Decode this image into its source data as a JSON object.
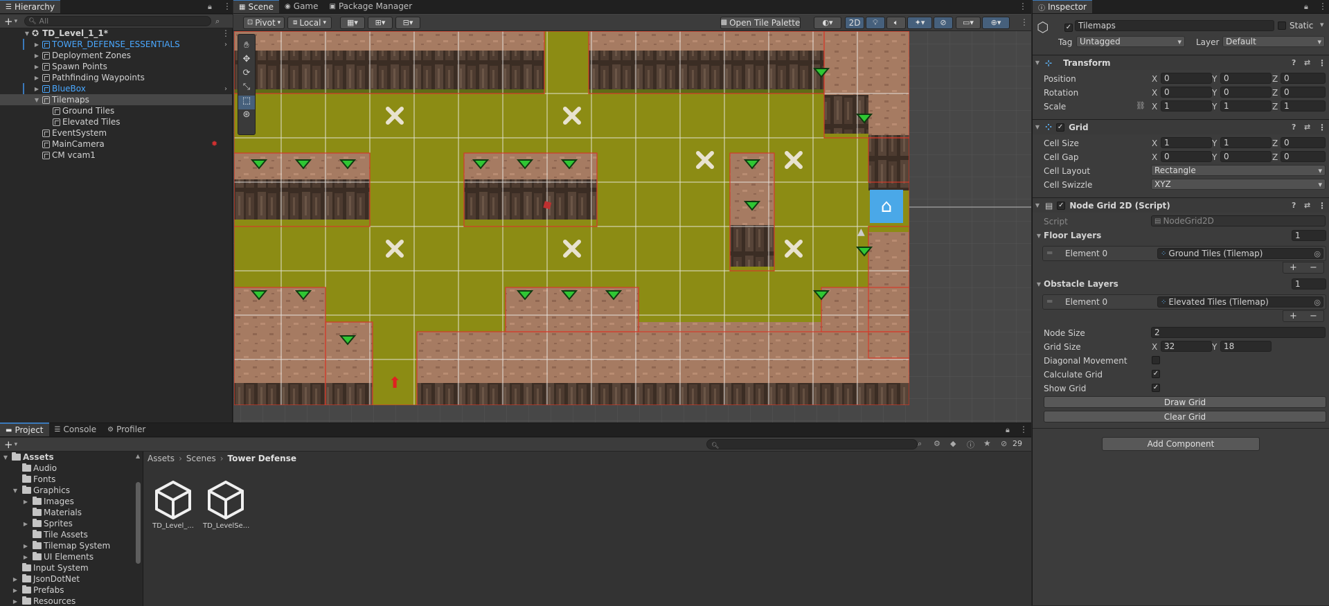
{
  "hierarchy": {
    "tab_label": "Hierarchy",
    "search_placeholder": "All",
    "scene_name": "TD_Level_1_1*",
    "items": [
      {
        "label": "TOWER_DEFENSE_ESSENTIALS",
        "color": "#4aa8ff"
      },
      {
        "label": "Deployment Zones"
      },
      {
        "label": "Spawn Points"
      },
      {
        "label": "Pathfinding Waypoints"
      },
      {
        "label": "BlueBox",
        "color": "#4aa8ff"
      },
      {
        "label": "Tilemaps"
      },
      {
        "label": "Ground Tiles"
      },
      {
        "label": "Elevated Tiles"
      },
      {
        "label": "EventSystem"
      },
      {
        "label": "MainCamera"
      },
      {
        "label": "CM vcam1"
      }
    ]
  },
  "scene_tabs": [
    {
      "label": "Scene",
      "icon": "grid-icon"
    },
    {
      "label": "Game",
      "icon": "gamepad-icon"
    },
    {
      "label": "Package Manager",
      "icon": "package-icon"
    }
  ],
  "scene_toolbar": {
    "pivot": "Pivot",
    "local": "Local",
    "open_tile_palette": "Open Tile Palette",
    "mode_2d": "2D"
  },
  "inspector": {
    "tab_label": "Inspector",
    "object_name": "Tilemaps",
    "static_label": "Static",
    "tag_label": "Tag",
    "tag_value": "Untagged",
    "layer_label": "Layer",
    "layer_value": "Default",
    "transform": {
      "title": "Transform",
      "position_label": "Position",
      "position": [
        "0",
        "0",
        "0"
      ],
      "rotation_label": "Rotation",
      "rotation": [
        "0",
        "0",
        "0"
      ],
      "scale_label": "Scale",
      "scale": [
        "1",
        "1",
        "1"
      ]
    },
    "grid": {
      "title": "Grid",
      "cell_size_label": "Cell Size",
      "cell_size": [
        "1",
        "1",
        "0"
      ],
      "cell_gap_label": "Cell Gap",
      "cell_gap": [
        "0",
        "0",
        "0"
      ],
      "cell_layout_label": "Cell Layout",
      "cell_layout": "Rectangle",
      "cell_swizzle_label": "Cell Swizzle",
      "cell_swizzle": "XYZ"
    },
    "node_grid": {
      "title": "Node Grid 2D (Script)",
      "script_label": "Script",
      "script_value": "NodeGrid2D",
      "floor_layers_label": "Floor Layers",
      "floor_layers_count": "1",
      "floor_element_label": "Element 0",
      "floor_element_value": "Ground Tiles (Tilemap)",
      "obstacle_layers_label": "Obstacle Layers",
      "obstacle_layers_count": "1",
      "obstacle_element_label": "Element 0",
      "obstacle_element_value": "Elevated Tiles (Tilemap)",
      "node_size_label": "Node Size",
      "node_size": "2",
      "grid_size_label": "Grid Size",
      "grid_size_x": "32",
      "grid_size_y": "18",
      "diagonal_label": "Diagonal Movement",
      "diagonal": false,
      "calculate_label": "Calculate Grid",
      "calculate": true,
      "show_label": "Show Grid",
      "show": true,
      "draw_button": "Draw Grid",
      "clear_button": "Clear Grid"
    },
    "add_component": "Add Component",
    "axis_x": "X",
    "axis_y": "Y",
    "axis_z": "Z"
  },
  "project": {
    "tabs": [
      {
        "label": "Project",
        "icon": "folder-icon"
      },
      {
        "label": "Console",
        "icon": "console-icon"
      },
      {
        "label": "Profiler",
        "icon": "profiler-icon"
      }
    ],
    "hidden_count": "29",
    "breadcrumb": [
      "Assets",
      "Scenes",
      "Tower Defense"
    ],
    "tree": [
      {
        "label": "Assets",
        "bold": true
      },
      {
        "label": "Audio"
      },
      {
        "label": "Fonts"
      },
      {
        "label": "Graphics"
      },
      {
        "label": "Images"
      },
      {
        "label": "Materials"
      },
      {
        "label": "Sprites"
      },
      {
        "label": "Tile Assets"
      },
      {
        "label": "Tilemap System"
      },
      {
        "label": "UI Elements"
      },
      {
        "label": "Input System"
      },
      {
        "label": "JsonDotNet"
      },
      {
        "label": "Prefabs"
      },
      {
        "label": "Resources"
      }
    ],
    "assets": [
      {
        "label": "TD_Level_..."
      },
      {
        "label": "TD_LevelSe..."
      }
    ]
  },
  "colors": {
    "accent": "#3a79bb",
    "ground": "#8c8c14",
    "dirt": "#a47a62",
    "rock": "#3e2f25",
    "grid_line_white": "#f0f0f0",
    "grid_line_red": "#d43a2a",
    "base": "#4aa8e8",
    "tower_marker": "#2ec833"
  }
}
